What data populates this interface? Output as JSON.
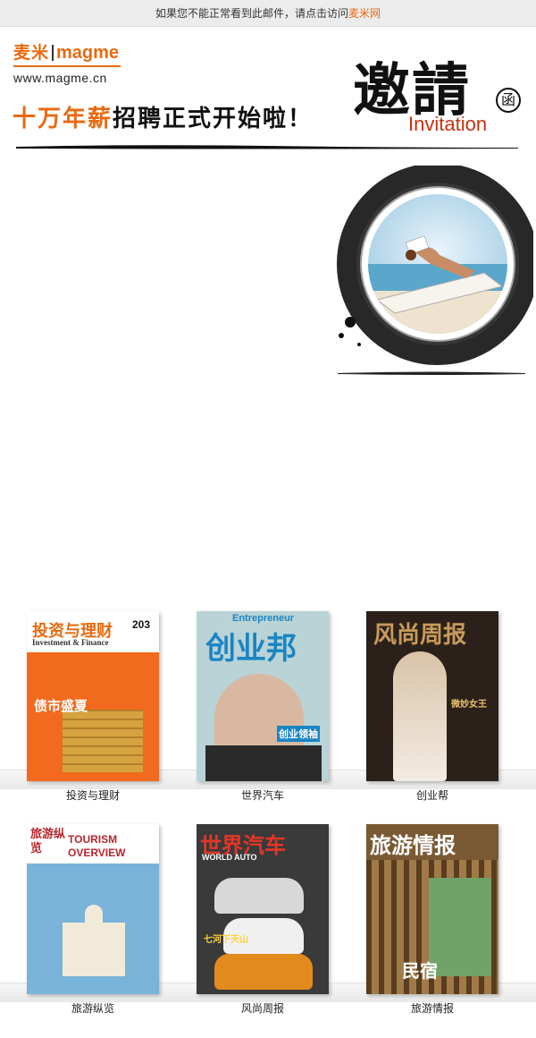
{
  "notice": {
    "text": "如果您不能正常看到此邮件，请点击访问",
    "link": "麦米网"
  },
  "logo": {
    "cn": "麦米",
    "en": "magme",
    "url": "www.magme.cn"
  },
  "headline": {
    "orange": "十万年薪",
    "black": "招聘正式开始啦！"
  },
  "invitation": {
    "chinese": "邀請",
    "seal": "函",
    "english": "Invitation"
  },
  "magazines": [
    {
      "label": "投资与理财",
      "cover_title": "投资与理财",
      "cover_sub": "Investment & Finance",
      "cover_issue": "203",
      "cover_headline": "债市盛夏"
    },
    {
      "label": "世界汽车",
      "cover_title": "创业邦",
      "cover_sub": "Entrepreneur",
      "cover_headline": "创业领袖"
    },
    {
      "label": "创业帮",
      "cover_title": "风尚周报",
      "cover_headline": "微妙女王"
    },
    {
      "label": "旅游纵览",
      "cover_title": "旅游纵览",
      "cover_sub": "TOURISM OVERVIEW"
    },
    {
      "label": "风尚周报",
      "cover_title": "世界汽车",
      "cover_sub": "WORLD AUTO",
      "cover_headline": "七河下天山"
    },
    {
      "label": "旅游情报",
      "cover_title": "旅游情报",
      "cover_headline": "民宿"
    }
  ],
  "colors": {
    "brand_orange": "#e86a10",
    "invitation_red": "#c8320f"
  }
}
